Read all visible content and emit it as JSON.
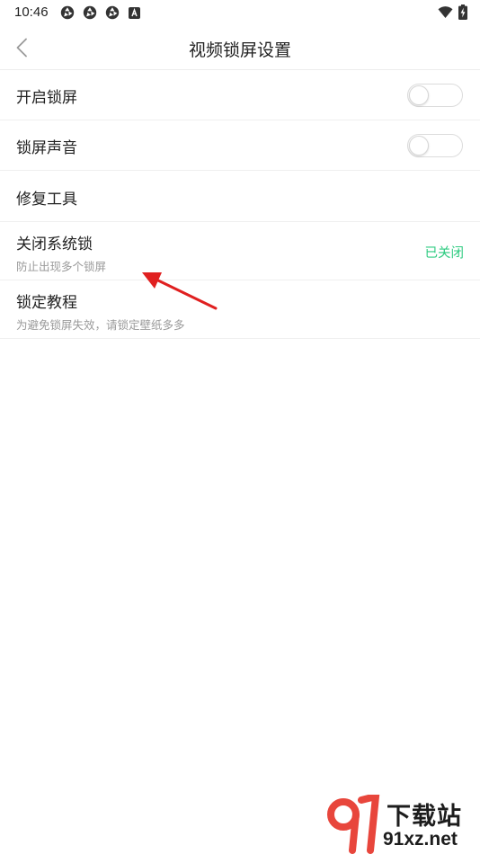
{
  "status_bar": {
    "time": "10:46",
    "notification_icons": [
      "aperture-icon",
      "aperture-icon",
      "aperture-icon",
      "app-a-icon"
    ],
    "system_icons": [
      "wifi-icon",
      "battery-charging-icon"
    ]
  },
  "header": {
    "title": "视频锁屏设置",
    "back_icon": "chevron-left-icon"
  },
  "settings": [
    {
      "title": "开启锁屏",
      "control": "toggle",
      "enabled": false
    },
    {
      "title": "锁屏声音",
      "control": "toggle",
      "enabled": false
    },
    {
      "title": "修复工具"
    },
    {
      "title": "关闭系统锁",
      "subtitle": "防止出现多个锁屏",
      "status": "已关闭"
    },
    {
      "title": "锁定教程",
      "subtitle": "为避免锁屏失效，请锁定壁纸多多"
    }
  ],
  "colors": {
    "status_green": "#2ecb80",
    "annotation_red": "#e02020",
    "watermark_red": "#e8463c"
  },
  "watermark": {
    "top_text": "下载站",
    "bottom_text": "91xz.net"
  }
}
